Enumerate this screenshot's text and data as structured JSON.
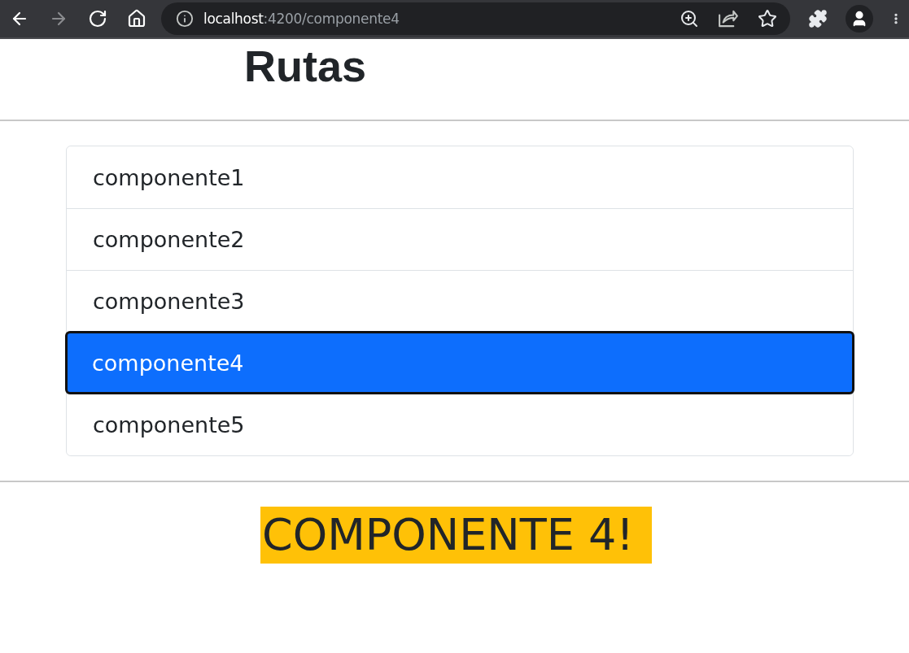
{
  "browser": {
    "nav_buttons": [
      {
        "kind": "back",
        "disabled": false
      },
      {
        "kind": "forward",
        "disabled": true
      },
      {
        "kind": "reload",
        "disabled": false
      },
      {
        "kind": "home",
        "disabled": false
      }
    ],
    "address": {
      "host": "localhost",
      "path": ":4200/componente4"
    }
  },
  "title": "Rutas",
  "routes": [
    {
      "label": "componente1",
      "selected": false
    },
    {
      "label": "componente2",
      "selected": false
    },
    {
      "label": "componente3",
      "selected": false
    },
    {
      "label": "componente4",
      "selected": true
    },
    {
      "label": "componente5",
      "selected": false
    }
  ],
  "banner": "COMPONENTE 4!"
}
